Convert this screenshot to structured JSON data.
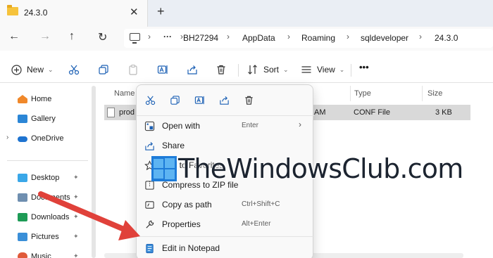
{
  "tab": {
    "title": "24.3.0",
    "close_glyph": "✕",
    "new_tab_glyph": "+"
  },
  "nav": {
    "back": "←",
    "forward": "→",
    "up": "↑",
    "refresh": "↻"
  },
  "breadcrumb": {
    "more": "···",
    "separator": "›",
    "items": [
      "BH27294",
      "AppData",
      "Roaming",
      "sqldeveloper",
      "24.3.0"
    ]
  },
  "toolbar": {
    "new_label": "New",
    "sort_label": "Sort",
    "view_label": "View",
    "more_label": "•••"
  },
  "sidebar": {
    "pin_glyph": "📌",
    "items": [
      {
        "label": "Home",
        "color": "#f0882a"
      },
      {
        "label": "Gallery",
        "color": "#2b86d6"
      },
      {
        "label": "OneDrive",
        "color": "#1e73d0"
      },
      {
        "label": "Desktop",
        "color": "#3aa7e8"
      },
      {
        "label": "Documents",
        "color": "#6f8fb0"
      },
      {
        "label": "Downloads",
        "color": "#1e9b56"
      },
      {
        "label": "Pictures",
        "color": "#3a8fd8"
      },
      {
        "label": "Music",
        "color": "#e05a3a"
      }
    ]
  },
  "columns": {
    "name": "Name",
    "type": "Type",
    "size": "Size"
  },
  "file": {
    "name": "prod",
    "modified_partial": "AM",
    "type": "CONF File",
    "size": "3 KB"
  },
  "context_menu": {
    "items": [
      {
        "label": "Open with",
        "shortcut": "Enter",
        "submenu": "›"
      },
      {
        "label": "Share",
        "shortcut": ""
      },
      {
        "label": "Add to Favorites",
        "shortcut": ""
      },
      {
        "label": "Compress to ZIP file",
        "shortcut": ""
      },
      {
        "label": "Copy as path",
        "shortcut": "Ctrl+Shift+C"
      },
      {
        "label": "Properties",
        "shortcut": "Alt+Enter"
      },
      {
        "label": "Edit in Notepad",
        "shortcut": ""
      }
    ]
  },
  "watermark": {
    "text": "TheWindowsClub.com"
  },
  "colors": {
    "accent": "#0067c0",
    "arrow": "#e0413a",
    "selection": "#d9d9d9",
    "folder": "#f6c33c"
  }
}
